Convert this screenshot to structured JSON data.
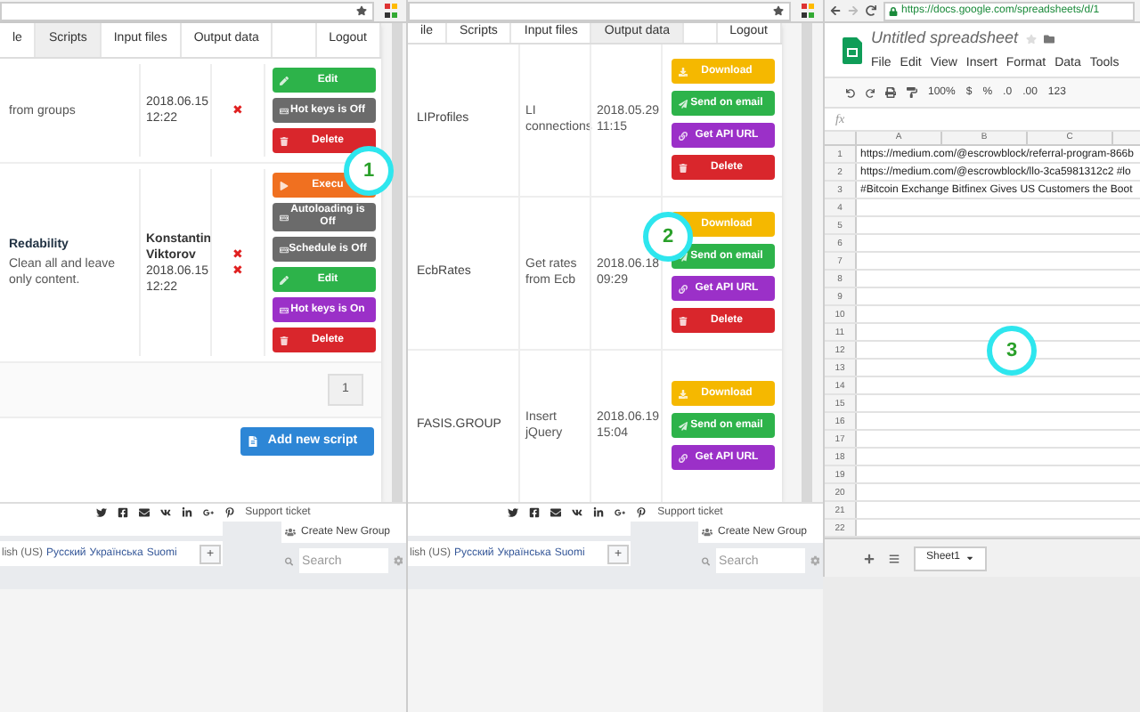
{
  "scripts_panel": {
    "tabs": [
      {
        "label": "le",
        "selected": false
      },
      {
        "label": "Scripts",
        "selected": true
      },
      {
        "label": "Input files",
        "selected": false
      },
      {
        "label": "Output data",
        "selected": false
      },
      {
        "label": "Logout",
        "selected": false
      }
    ],
    "rows": [
      {
        "name": "",
        "description": "from groups",
        "author": "",
        "date": "2018.06.15 12:22",
        "marks": [
          "✖"
        ],
        "buttons": [
          {
            "kind": "edit",
            "label": "Edit"
          },
          {
            "kind": "toggle",
            "label": "Hot keys is Off"
          },
          {
            "kind": "delete",
            "label": "Delete"
          }
        ]
      },
      {
        "name": "Redability",
        "description": "Clean all and leave only content.",
        "author": "Konstantin Viktorov",
        "date": "2018.06.15 12:22",
        "marks": [
          "✖",
          "✖"
        ],
        "buttons": [
          {
            "kind": "execute",
            "label": "Execu"
          },
          {
            "kind": "toggle",
            "label": "Autoloading is Off"
          },
          {
            "kind": "toggle",
            "label": "Schedule is Off"
          },
          {
            "kind": "edit",
            "label": "Edit"
          },
          {
            "kind": "toggle_on",
            "label": "Hot keys is On"
          },
          {
            "kind": "delete",
            "label": "Delete"
          }
        ]
      }
    ],
    "page": "1",
    "add_button": "Add new script",
    "footer_link": "Support ticket"
  },
  "output_panel": {
    "tabs": [
      {
        "label": "ile",
        "selected": false
      },
      {
        "label": "Scripts",
        "selected": false
      },
      {
        "label": "Input files",
        "selected": false
      },
      {
        "label": "Output data",
        "selected": true
      },
      {
        "label": "Logout",
        "selected": false
      }
    ],
    "rows": [
      {
        "name": "LIProfiles",
        "description": "LI connections",
        "date": "2018.05.29 11:15",
        "buttons": [
          {
            "kind": "download",
            "label": "Download"
          },
          {
            "kind": "email",
            "label": "Send on email"
          },
          {
            "kind": "api",
            "label": "Get API URL"
          },
          {
            "kind": "delete",
            "label": "Delete"
          }
        ]
      },
      {
        "name": "EcbRates",
        "description": "Get rates from Ecb",
        "date": "2018.06.18 09:29",
        "buttons": [
          {
            "kind": "download",
            "label": "Download"
          },
          {
            "kind": "email",
            "label": "Send on email"
          },
          {
            "kind": "api",
            "label": "Get API URL"
          },
          {
            "kind": "delete",
            "label": "Delete"
          }
        ]
      },
      {
        "name": "FASIS.GROUP",
        "description": "Insert jQuery",
        "date": "2018.06.19 15:04",
        "buttons": [
          {
            "kind": "download",
            "label": "Download"
          },
          {
            "kind": "email",
            "label": "Send on email"
          },
          {
            "kind": "api",
            "label": "Get API URL"
          }
        ]
      }
    ],
    "footer_link": "Support ticket"
  },
  "background_pages": [
    {
      "languages": [
        "lish (US)",
        "Русский",
        "Українська",
        "Suomi"
      ],
      "add": "+",
      "create_group": "Create New Group",
      "search_placeholder": "Search"
    },
    {
      "languages": [
        "lish (US)",
        "Русский",
        "Українська",
        "Suomi"
      ],
      "add": "+",
      "create_group": "Create New Group",
      "search_placeholder": "Search"
    }
  ],
  "spreadsheet": {
    "url": "https://docs.google.com/spreadsheets/d/1",
    "title": "Untitled spreadsheet",
    "menu": [
      "File",
      "Edit",
      "View",
      "Insert",
      "Format",
      "Data",
      "Tools"
    ],
    "toolbar": [
      "100%",
      "$",
      "%",
      ".0",
      ".00",
      "123"
    ],
    "formula_label": "fx",
    "columns": [
      "A",
      "B",
      "C"
    ],
    "rows": [
      {
        "number": "1",
        "cell": "https://medium.com/@escrowblock/referral-program-866b"
      },
      {
        "number": "2",
        "cell": "https://medium.com/@escrowblock/llo-3ca5981312c2 #lo"
      },
      {
        "number": "3",
        "cell": "#Bitcoin Exchange Bitfinex Gives US Customers the Boot"
      },
      {
        "number": "4",
        "cell": ""
      },
      {
        "number": "5",
        "cell": ""
      },
      {
        "number": "6",
        "cell": ""
      },
      {
        "number": "7",
        "cell": ""
      },
      {
        "number": "8",
        "cell": ""
      },
      {
        "number": "9",
        "cell": ""
      },
      {
        "number": "10",
        "cell": ""
      },
      {
        "number": "11",
        "cell": ""
      },
      {
        "number": "12",
        "cell": ""
      },
      {
        "number": "13",
        "cell": ""
      },
      {
        "number": "14",
        "cell": ""
      },
      {
        "number": "15",
        "cell": ""
      },
      {
        "number": "16",
        "cell": ""
      },
      {
        "number": "17",
        "cell": ""
      },
      {
        "number": "18",
        "cell": ""
      },
      {
        "number": "19",
        "cell": ""
      },
      {
        "number": "20",
        "cell": ""
      },
      {
        "number": "21",
        "cell": ""
      },
      {
        "number": "22",
        "cell": ""
      }
    ],
    "sheet_tab": "Sheet1"
  },
  "callouts": [
    "1",
    "2",
    "3"
  ]
}
